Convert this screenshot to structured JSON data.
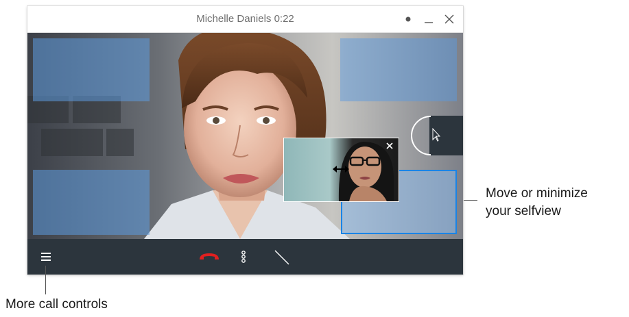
{
  "window": {
    "title": "Michelle Daniels 0:22"
  },
  "annotations": {
    "selfview_line1": "Move or minimize",
    "selfview_line2": "your selfview",
    "more_controls": "More call controls"
  },
  "icons": {
    "status": "status-dot-icon",
    "minimize": "minimize-icon",
    "close": "close-icon",
    "menu": "hamburger-menu-icon",
    "hangup": "hang-up-phone-icon",
    "more": "more-vertical-icon",
    "mute": "muted-slash-icon",
    "resize": "resize-arrows-icon",
    "selfview_close": "selfview-close-icon"
  },
  "colors": {
    "control_bar": "#2c353d",
    "hangup_red": "#e02020",
    "selfview_border": "#1a84e6",
    "title_text": "#6f6f6f"
  }
}
